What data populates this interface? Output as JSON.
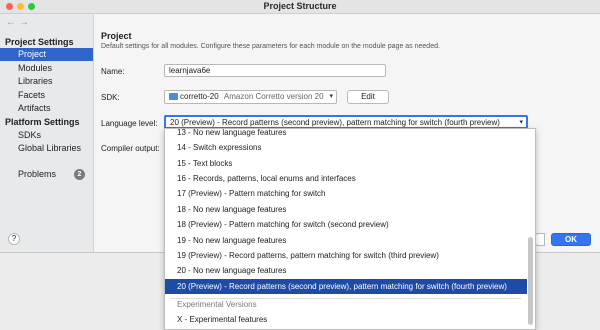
{
  "window": {
    "title": "Project Structure"
  },
  "colors": {
    "close": "#ff5f57",
    "minimize": "#febc2e",
    "zoom": "#28c840",
    "selection": "#2f65ca",
    "accent": "#3574f0"
  },
  "nav": {
    "back": "←",
    "forward": "→"
  },
  "sidebar": {
    "sections": [
      {
        "title": "Project Settings",
        "items": [
          "Project",
          "Modules",
          "Libraries",
          "Facets",
          "Artifacts"
        ]
      },
      {
        "title": "Platform Settings",
        "items": [
          "SDKs",
          "Global Libraries"
        ]
      }
    ],
    "problems": {
      "label": "Problems",
      "count": "2"
    },
    "selected": "Project"
  },
  "main": {
    "heading": "Project",
    "description": "Default settings for all modules. Configure these parameters for each module on the module page as needed.",
    "name_label": "Name:",
    "name_value": "learnjava6e",
    "sdk_label": "SDK:",
    "sdk_value": "corretto-20",
    "sdk_detail": "Amazon Corretto version 20",
    "sdk_edit": "Edit",
    "language_label": "Language level:",
    "language_value": "20 (Preview) - Record patterns (second preview), pattern matching for switch (fourth preview)",
    "compiler_label": "Compiler output:"
  },
  "footer": {
    "help": "?",
    "ok": "OK"
  },
  "dropdown": {
    "options": [
      "13 - No new language features",
      "14 - Switch expressions",
      "15 - Text blocks",
      "16 - Records, patterns, local enums and interfaces",
      "17 (Preview) - Pattern matching for switch",
      "18 - No new language features",
      "18 (Preview) - Pattern matching for switch (second preview)",
      "19 - No new language features",
      "19 (Preview) - Record patterns, pattern matching for switch (third preview)",
      "20 - No new language features",
      "20 (Preview) - Record patterns (second preview), pattern matching for switch (fourth preview)"
    ],
    "selected_index": 10,
    "group_label": "Experimental Versions",
    "experimental": "X - Experimental features"
  }
}
